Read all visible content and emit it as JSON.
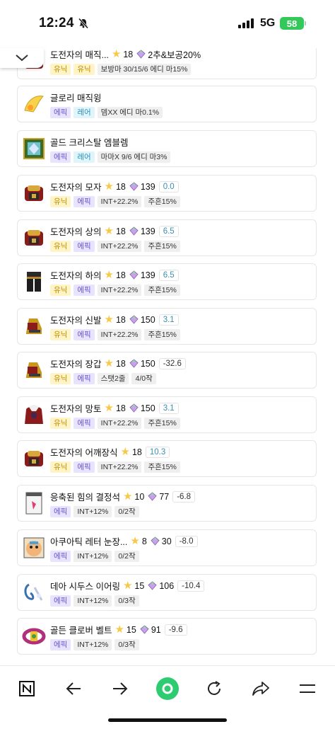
{
  "status_bar": {
    "time": "12:24",
    "network": "5G",
    "battery": "58"
  },
  "items": [
    {
      "name": "도전자의 매직...",
      "star": "18",
      "gem": "2추&보공20%",
      "score": "",
      "tags": [
        [
          "유닉",
          "unique"
        ],
        [
          "유닉",
          "unique"
        ],
        [
          "보방마 30/15/6 에디 마15%",
          "plain"
        ]
      ],
      "icon": "red"
    },
    {
      "name": "글로리 매직윙",
      "star": "",
      "gem": "",
      "score": "",
      "tags": [
        [
          "에픽",
          "epic"
        ],
        [
          "레어",
          "rare"
        ],
        [
          "뎀XX 에디 마0.1%",
          "plain"
        ]
      ],
      "icon": "wing"
    },
    {
      "name": "골드 크리스탈 엠블렘",
      "star": "",
      "gem": "",
      "score": "",
      "tags": [
        [
          "에픽",
          "epic"
        ],
        [
          "레어",
          "rare"
        ],
        [
          "마마X 9/6 에디 마3%",
          "plain"
        ]
      ],
      "icon": "emblem"
    },
    {
      "name": "도전자의 모자",
      "star": "18",
      "gem": "139",
      "score": "0.0",
      "tags": [
        [
          "유닉",
          "unique"
        ],
        [
          "에픽",
          "epic"
        ],
        [
          "INT+22.2%",
          "plain"
        ],
        [
          "주흔15%",
          "plain"
        ]
      ],
      "icon": "red"
    },
    {
      "name": "도전자의 상의",
      "star": "18",
      "gem": "139",
      "score": "6.5",
      "tags": [
        [
          "유닉",
          "unique"
        ],
        [
          "에픽",
          "epic"
        ],
        [
          "INT+22.2%",
          "plain"
        ],
        [
          "주흔15%",
          "plain"
        ]
      ],
      "icon": "red"
    },
    {
      "name": "도전자의 하의",
      "star": "18",
      "gem": "139",
      "score": "6.5",
      "tags": [
        [
          "유닉",
          "unique"
        ],
        [
          "에픽",
          "epic"
        ],
        [
          "INT+22.2%",
          "plain"
        ],
        [
          "주흔15%",
          "plain"
        ]
      ],
      "icon": "dark"
    },
    {
      "name": "도전자의 신발",
      "star": "18",
      "gem": "150",
      "score": "3.1",
      "tags": [
        [
          "유닉",
          "unique"
        ],
        [
          "에픽",
          "epic"
        ],
        [
          "INT+22.2%",
          "plain"
        ],
        [
          "주흔15%",
          "plain"
        ]
      ],
      "icon": "gold"
    },
    {
      "name": "도전자의 장갑",
      "star": "18",
      "gem": "150",
      "score": "-32.6",
      "tags": [
        [
          "유닉",
          "unique"
        ],
        [
          "에픽",
          "epic"
        ],
        [
          "스탯2줄",
          "plain"
        ],
        [
          "4/0작",
          "plain"
        ]
      ],
      "icon": "gold"
    },
    {
      "name": "도전자의 망토",
      "star": "18",
      "gem": "150",
      "score": "3.1",
      "tags": [
        [
          "유닉",
          "unique"
        ],
        [
          "에픽",
          "epic"
        ],
        [
          "INT+22.2%",
          "plain"
        ],
        [
          "주흔15%",
          "plain"
        ]
      ],
      "icon": "cape"
    },
    {
      "name": "도전자의 어깨장식",
      "star": "18",
      "gem": "",
      "score": "10.3",
      "tags": [
        [
          "유닉",
          "unique"
        ],
        [
          "에픽",
          "epic"
        ],
        [
          "INT+22.2%",
          "plain"
        ],
        [
          "주흔15%",
          "plain"
        ]
      ],
      "icon": "red"
    },
    {
      "name": "응축된 힘의 결정석",
      "star": "10",
      "gem": "77",
      "score": "-6.8",
      "tags": [
        [
          "에픽",
          "epic"
        ],
        [
          "INT+12%",
          "plain"
        ],
        [
          "0/2작",
          "plain"
        ]
      ],
      "icon": "card"
    },
    {
      "name": "아쿠아틱 레터 눈장...",
      "star": "8",
      "gem": "30",
      "score": "-8.0",
      "tags": [
        [
          "에픽",
          "epic"
        ],
        [
          "INT+12%",
          "plain"
        ],
        [
          "0/2작",
          "plain"
        ]
      ],
      "icon": "face"
    },
    {
      "name": "데아 시두스 이어링",
      "star": "15",
      "gem": "106",
      "score": "-10.4",
      "tags": [
        [
          "에픽",
          "epic"
        ],
        [
          "INT+12%",
          "plain"
        ],
        [
          "0/3작",
          "plain"
        ]
      ],
      "icon": "ear"
    },
    {
      "name": "골든 클로버 벨트",
      "star": "15",
      "gem": "91",
      "score": "-9.6",
      "tags": [
        [
          "에픽",
          "epic"
        ],
        [
          "INT+12%",
          "plain"
        ],
        [
          "0/3작",
          "plain"
        ]
      ],
      "icon": "belt"
    }
  ],
  "nav": {
    "icons": [
      "notion-icon",
      "back-arrow-icon",
      "forward-arrow-icon",
      "home-circle-icon",
      "refresh-icon",
      "share-icon",
      "menu-icon"
    ]
  },
  "colors": {
    "unique_bg": "#fff4c6",
    "epic_bg": "#e8e3ff",
    "rare_bg": "#dff4fb",
    "score_pos": "#3a8fb0",
    "home_green": "#2ecc71"
  }
}
